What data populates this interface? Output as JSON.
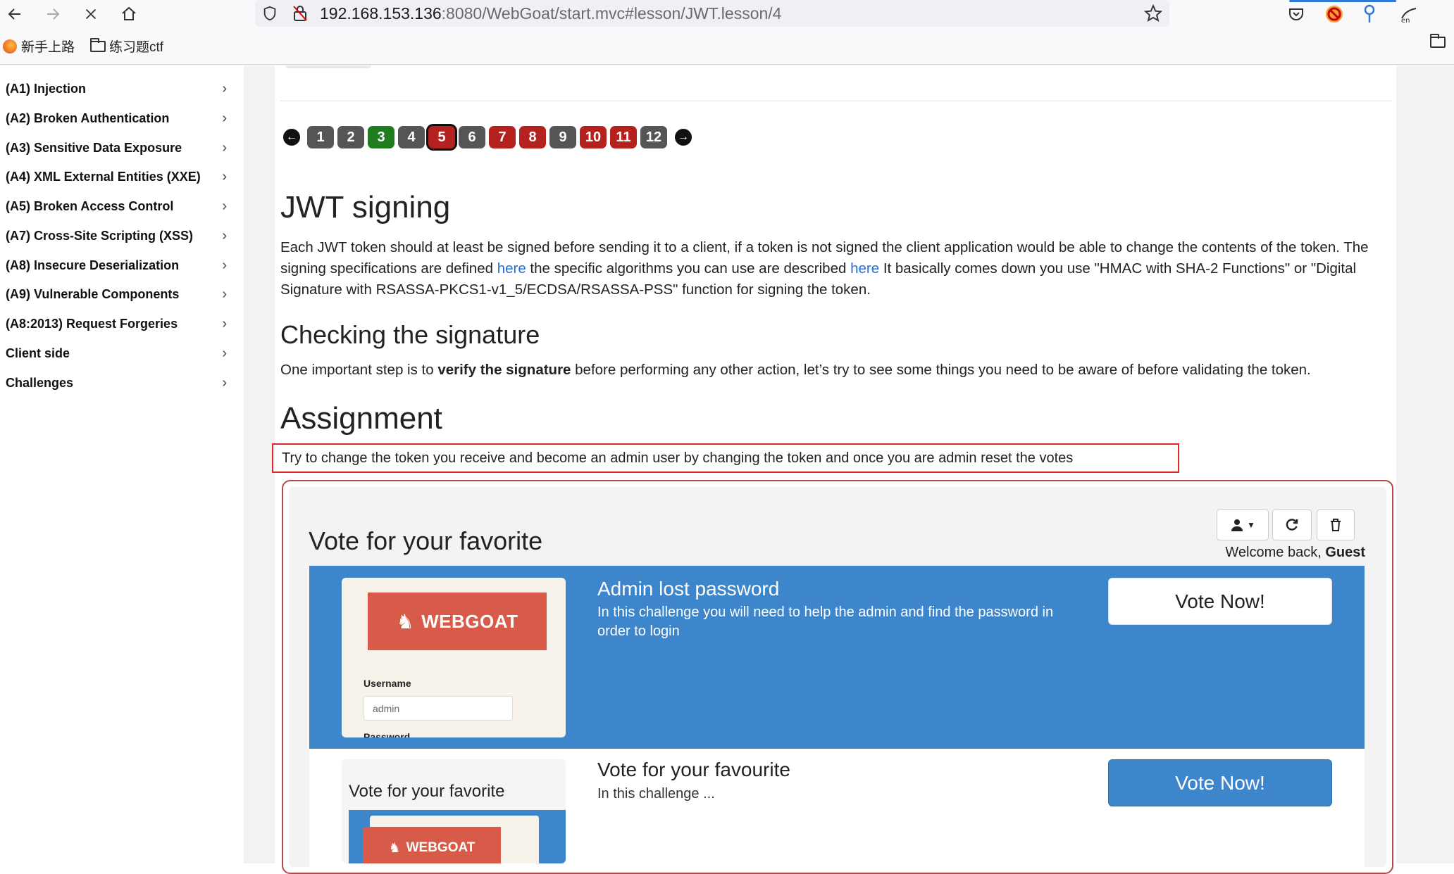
{
  "browser": {
    "url_host": "192.168.153.136",
    "url_rest": ":8080/WebGoat/start.mvc#lesson/JWT.lesson/4",
    "bookmarks": [
      "新手上路",
      "练习题ctf"
    ]
  },
  "sidebar": {
    "items": [
      {
        "label": "(A1) Injection"
      },
      {
        "label": "(A2) Broken Authentication"
      },
      {
        "label": "(A3) Sensitive Data Exposure"
      },
      {
        "label": "(A4) XML External Entities (XXE)"
      },
      {
        "label": "(A5) Broken Access Control"
      },
      {
        "label": "(A7) Cross-Site Scripting (XSS)"
      },
      {
        "label": "(A8) Insecure Deserialization"
      },
      {
        "label": "(A9) Vulnerable Components"
      },
      {
        "label": "(A8:2013) Request Forgeries"
      },
      {
        "label": "Client side"
      },
      {
        "label": "Challenges"
      }
    ]
  },
  "pager": {
    "pages": [
      {
        "label": "1",
        "status": "gray"
      },
      {
        "label": "2",
        "status": "gray"
      },
      {
        "label": "3",
        "status": "green"
      },
      {
        "label": "4",
        "status": "gray"
      },
      {
        "label": "5",
        "status": "current"
      },
      {
        "label": "6",
        "status": "gray"
      },
      {
        "label": "7",
        "status": "red"
      },
      {
        "label": "8",
        "status": "red"
      },
      {
        "label": "9",
        "status": "gray"
      },
      {
        "label": "10",
        "status": "red"
      },
      {
        "label": "11",
        "status": "red"
      },
      {
        "label": "12",
        "status": "gray"
      }
    ]
  },
  "lesson": {
    "title": "JWT signing",
    "intro_1": "Each JWT token should at least be signed before sending it to a client, if a token is not signed the client application would be able to change the contents of the token. The signing specifications are defined ",
    "link_1": "here",
    "intro_2": " the specific algorithms you can use are described ",
    "link_2": "here",
    "intro_3": " It basically comes down you use \"HMAC with SHA-2 Functions\" or \"Digital Signature with RSASSA-PKCS1-v1_5/ECDSA/RSASSA-PSS\" function for signing the token.",
    "checking_title": "Checking the signature",
    "checking_1": "One important step is to ",
    "checking_bold": "verify the signature",
    "checking_2": " before performing any other action, let’s try to see some things you need to be aware of before validating the token.",
    "assignment_title": "Assignment",
    "assignment_text": "Try to change the token you receive and become an admin user by changing the token and once you are admin reset the votes"
  },
  "vote": {
    "title": "Vote for your favorite",
    "welcome_prefix": "Welcome back, ",
    "welcome_user": "Guest",
    "cards": [
      {
        "title": "Admin lost password",
        "desc": "In this challenge you will need to help the admin and find the password in order to login",
        "button": "Vote Now!",
        "thumb_brand": "WEBGOAT",
        "thumb_username_label": "Username",
        "thumb_username_value": "admin",
        "thumb_password_label": "Password"
      },
      {
        "title": "Vote for your favourite",
        "desc": "In this challenge ...",
        "button": "Vote Now!",
        "thumb_title": "Vote for your favorite",
        "thumb_brand": "WEBGOAT"
      }
    ]
  },
  "colors": {
    "vote_blue": "#3e86cb",
    "webgoat_red": "#d85a48",
    "assignment_highlight": "#e0282b"
  }
}
